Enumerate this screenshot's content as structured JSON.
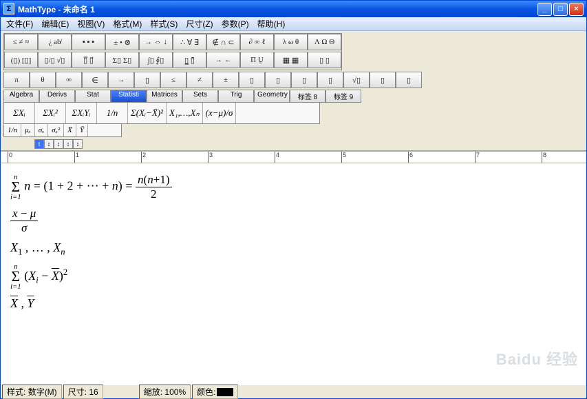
{
  "window": {
    "app_icon": "Σ",
    "title": "MathType - 未命名 1",
    "btn_min": "_",
    "btn_max": "□",
    "btn_close": "×"
  },
  "menu": {
    "file": "文件(F)",
    "edit": "编辑(E)",
    "view": "视图(V)",
    "format": "格式(M)",
    "style": "样式(S)",
    "size": "尺寸(Z)",
    "params": "参数(P)",
    "help": "帮助(H)"
  },
  "palettes": {
    "row1": [
      "≤ ≠ ≈",
      "¿ ab̸",
      "▪ ▪ ▪",
      "± • ⊗",
      "→ ⇔ ↓",
      "∴ ∀ ∃",
      "∉ ∩ ⊂",
      "∂ ∞ ℓ",
      "λ ω θ",
      "Λ Ω Θ"
    ],
    "row2": [
      "(▯) [▯]",
      "▯/▯  √▯",
      "▯̅ ▯⃗",
      "Σ▯ Σ▯",
      "∫▯ ∮▯",
      "▯̲ ▯̄",
      "→ ←",
      "Π Ṵ",
      "▦ ▦",
      "▯ ▯"
    ],
    "row3": [
      "π",
      "θ",
      "∞",
      "∈",
      "→",
      "▯",
      "≤",
      "≠",
      "±",
      "▯",
      "▯",
      "▯",
      "▯",
      "√▯",
      "▯",
      "▯"
    ]
  },
  "tabs": [
    "Algebra",
    "Derivs",
    "Stat",
    "Statisti",
    "Matrices",
    "Sets",
    "Trig",
    "Geometry",
    "标签 8",
    "标签 9"
  ],
  "active_tab": 3,
  "tpl_row1": [
    "ΣXᵢ",
    "ΣXᵢ²",
    "ΣXᵢYᵢ",
    "1/n",
    "Σ(Xᵢ−X̄)²",
    "X₁,…,Xₙ",
    "(x−μ)/σ"
  ],
  "tpl_row2": [
    "1/n",
    "μₓ",
    "σₓ",
    "σₓ²",
    "X̄",
    "Ȳ"
  ],
  "little_icons": [
    "t",
    "↕",
    "↕",
    "↕",
    "↕"
  ],
  "ruler_marks": [
    "0",
    "1",
    "2",
    "3",
    "4",
    "5",
    "6",
    "7",
    "8"
  ],
  "editor_lines": [
    "sum_formula",
    "(x − μ)/σ",
    "X₁ ,…, Xₙ",
    "sum_squares",
    "X̄ , Ȳ"
  ],
  "status": {
    "style_label": "样式:",
    "style_value": "数字(M)",
    "size_label": "尺寸:",
    "size_value": "16",
    "zoom_label": "缩放:",
    "zoom_value": "100%",
    "color_label": "颜色:"
  },
  "watermark": "Baidu 经验",
  "chart_data": {
    "type": "table",
    "title": "Equation editor content",
    "equations": [
      "\\sum_{i=1}^{n} n = (1+2+\\cdots+n) = \\frac{n(n+1)}{2}",
      "\\frac{x-\\mu}{\\sigma}",
      "X_1,\\ldots,X_n",
      "\\sum_{i=1}^{n} (X_i - \\bar{X})^2",
      "\\bar{X}, \\bar{Y}"
    ]
  }
}
